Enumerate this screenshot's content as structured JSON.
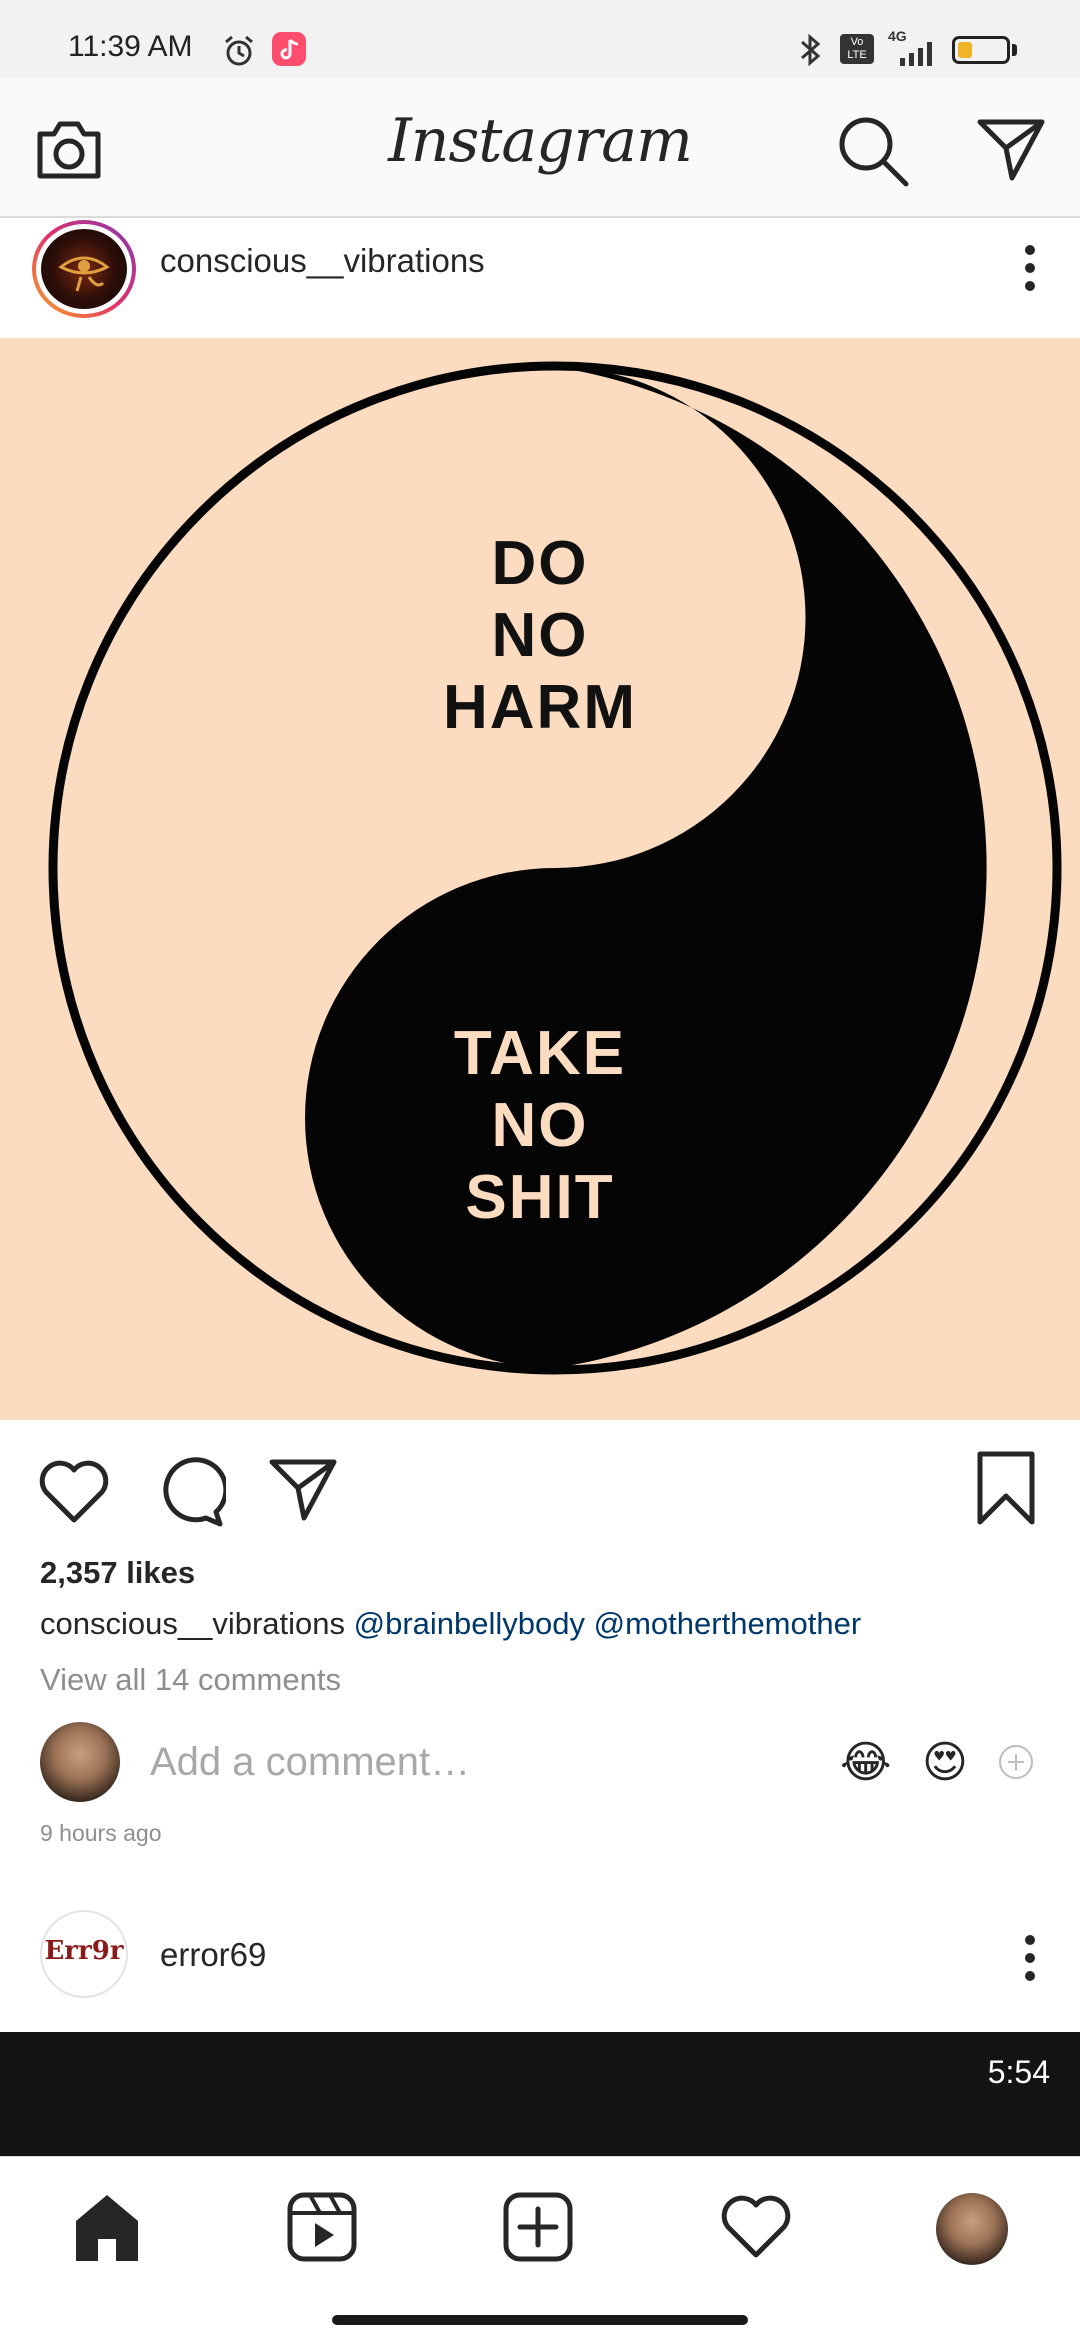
{
  "status_bar": {
    "time": "11:39 AM",
    "network": "4G",
    "volte": "Vo LTE",
    "icons": [
      "alarm-icon",
      "music-app-icon",
      "bluetooth-icon",
      "volte-icon",
      "signal-icon",
      "battery-icon"
    ],
    "battery_level": 0.3
  },
  "header": {
    "logo": "Instagram",
    "icons": [
      "camera-icon",
      "search-icon",
      "direct-message-icon"
    ]
  },
  "post": {
    "username": "conscious__vibrations",
    "image_text_top": [
      "DO",
      "NO",
      "HARM"
    ],
    "image_text_bottom": [
      "TAKE",
      "NO",
      "SHIT"
    ],
    "likes": "2,357 likes",
    "caption_user": "conscious__vibrations",
    "caption_mentions": "@brainbellybody @motherthemother",
    "view_comments": "View all 14 comments",
    "comment_placeholder": "Add a comment…",
    "emojis": [
      "😂",
      "😍"
    ],
    "timestamp": "9 hours ago"
  },
  "next_post": {
    "username": "error69",
    "avatar_text": "Err9r",
    "video_duration": "5:54"
  },
  "colors": {
    "image_bg": "#fbdcc0",
    "mention": "#00376b",
    "muted": "#8e8e8e"
  }
}
